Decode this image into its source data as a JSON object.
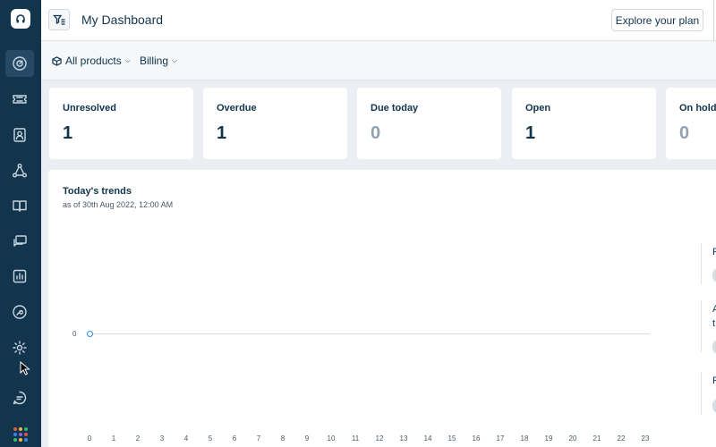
{
  "header": {
    "title": "My Dashboard",
    "explore_label": "Explore your plan"
  },
  "subbar": {
    "products_label": "All products",
    "billing_label": "Billing"
  },
  "sidebar": {
    "icons": [
      "dashboard-icon",
      "tickets-icon",
      "contacts-icon",
      "social-icon",
      "knowledge-base-icon",
      "conversations-icon",
      "reports-icon",
      "tools-icon",
      "settings-icon"
    ],
    "chat_icon": "chat-icon",
    "apps_icon": "apps-grid-icon",
    "grid_colors": [
      "#e1573f",
      "#f8b339",
      "#3bb27a",
      "#2c8ae8",
      "#8e5cd9",
      "#e1573f",
      "#3bb27a",
      "#f8b339",
      "#2c8ae8"
    ]
  },
  "cards": [
    {
      "label": "Unresolved",
      "value": "1"
    },
    {
      "label": "Overdue",
      "value": "1"
    },
    {
      "label": "Due today",
      "value": "0"
    },
    {
      "label": "Open",
      "value": "1"
    },
    {
      "label": "On hold",
      "value": "0"
    }
  ],
  "trends": {
    "title": "Today's trends",
    "subtitle": "as of 30th Aug 2022, 12:00 AM",
    "y_label": "0",
    "x_ticks": [
      "0",
      "1",
      "2",
      "3",
      "4",
      "5",
      "6",
      "7",
      "8",
      "9",
      "10",
      "11",
      "12",
      "13",
      "14",
      "15",
      "16",
      "17",
      "18",
      "19",
      "20",
      "21",
      "22",
      "23"
    ]
  },
  "right_panel": {
    "letters": [
      "R",
      "A",
      "t",
      "R"
    ]
  },
  "colors": {
    "sidebar_bg": "#12344d",
    "accent": "#2c8ae8",
    "muted_value": "#92a2b1"
  }
}
